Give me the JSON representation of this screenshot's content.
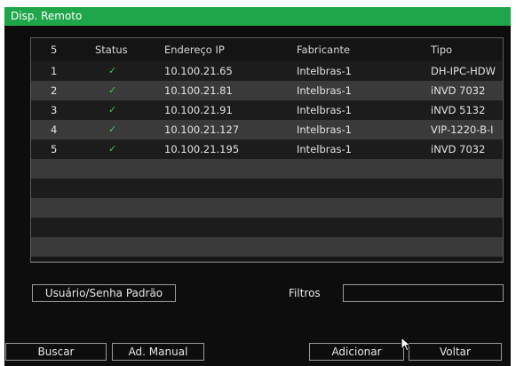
{
  "window": {
    "title": "Disp. Remoto"
  },
  "table": {
    "columns": [
      "5",
      "Status",
      "Endereço IP",
      "Fabricante",
      "Tipo"
    ],
    "rows": [
      {
        "num": "1",
        "status": "✓",
        "ip": "10.100.21.65",
        "fab": "Intelbras-1",
        "tipo": "DH-IPC-HDW"
      },
      {
        "num": "2",
        "status": "✓",
        "ip": "10.100.21.81",
        "fab": "Intelbras-1",
        "tipo": "iNVD 7032"
      },
      {
        "num": "3",
        "status": "✓",
        "ip": "10.100.21.91",
        "fab": "Intelbras-1",
        "tipo": "iNVD 5132"
      },
      {
        "num": "4",
        "status": "✓",
        "ip": "10.100.21.127",
        "fab": "Intelbras-1",
        "tipo": "VIP-1220-B-I"
      },
      {
        "num": "5",
        "status": "✓",
        "ip": "10.100.21.195",
        "fab": "Intelbras-1",
        "tipo": "iNVD 7032"
      }
    ]
  },
  "controls": {
    "default_credentials_label": "Usuário/Senha Padrão",
    "filters_label": "Filtros",
    "filters_value": ""
  },
  "footer": {
    "search_label": "Buscar",
    "manual_label": "Ad. Manual",
    "add_label": "Adicionar",
    "back_label": "Voltar"
  },
  "colors": {
    "titlebar": "#1fa64a",
    "check": "#4fbf5a",
    "background": "#0d0d0d"
  }
}
